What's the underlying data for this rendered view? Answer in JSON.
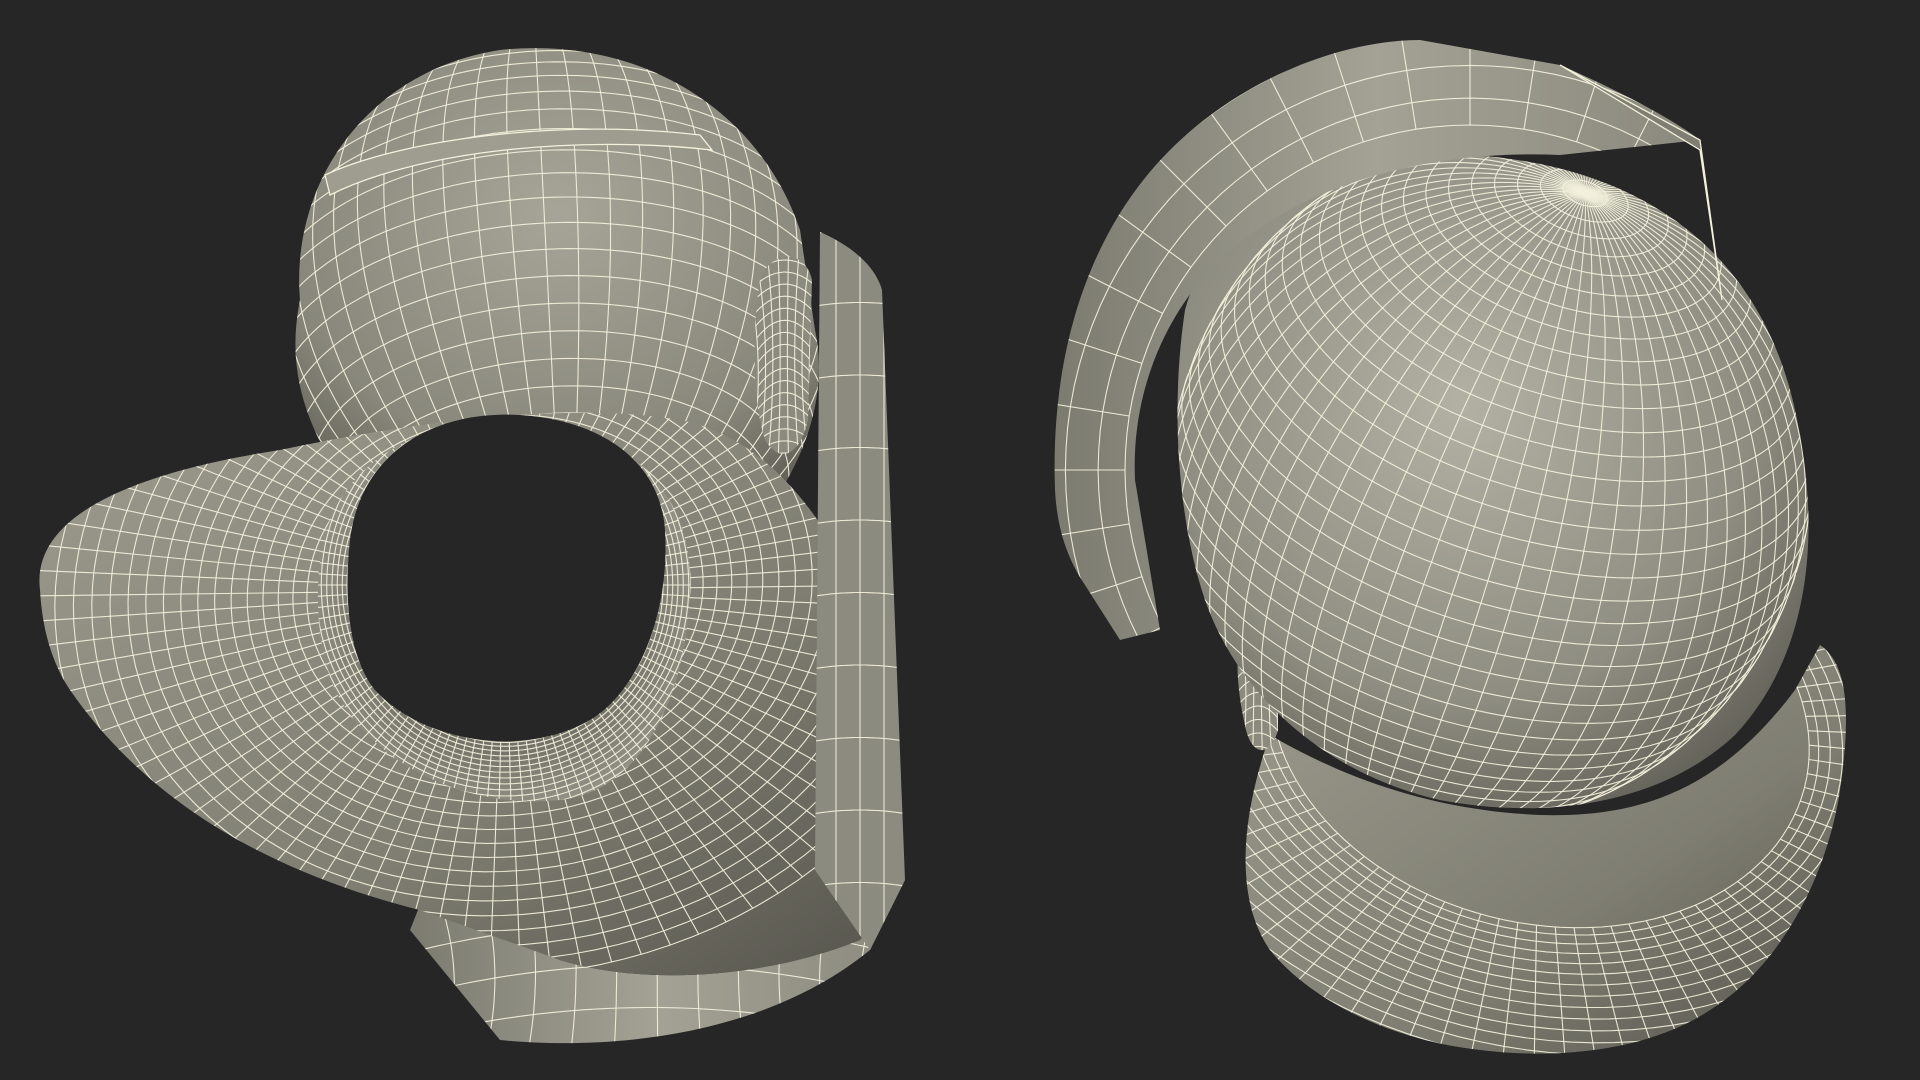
{
  "scene": {
    "background": "#262626",
    "mesh_fill": "#8d8c80",
    "mesh_fill_light": "#a9a89b",
    "mesh_fill_dark": "#5e5d54",
    "wire_color": "#f3f1dc",
    "models": [
      {
        "name": "head-model-underside-view",
        "view": "bottom"
      },
      {
        "name": "head-model-top-view",
        "view": "top"
      }
    ]
  }
}
